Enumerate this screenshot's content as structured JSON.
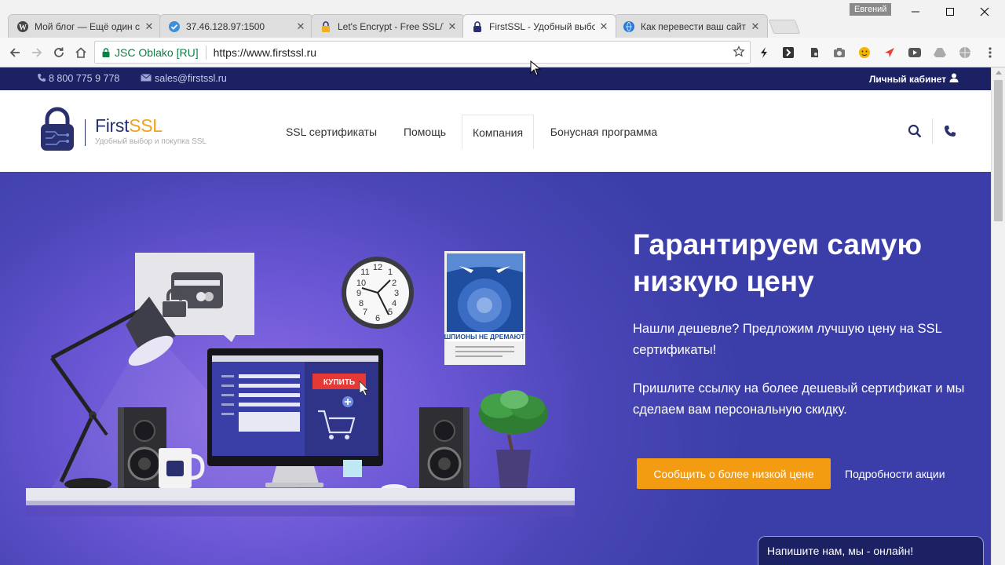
{
  "browser": {
    "tabs": [
      {
        "title": "Мой блог — Ещё один с",
        "icon": "wordpress-icon"
      },
      {
        "title": "37.46.128.97:1500",
        "icon": "checkmark-icon"
      },
      {
        "title": "Let's Encrypt - Free SSL/T",
        "icon": "lock-icon"
      },
      {
        "title": "FirstSSL - Удобный выбо",
        "icon": "firstssl-icon"
      },
      {
        "title": "Как перевести ваш сайт",
        "icon": "globe-icon"
      }
    ],
    "active_tab": 3,
    "profile_name": "Евгений",
    "secure_label": "JSC Oblako [RU]",
    "url": "https://www.firstssl.ru"
  },
  "site": {
    "topbar": {
      "phone": "8 800 775 9 778",
      "email": "sales@firstssl.ru",
      "account": "Личный кабинет"
    },
    "brand": {
      "name_first": "First",
      "name_ssl": "SSL",
      "tagline": "Удобный выбор и покупка SSL"
    },
    "nav": [
      {
        "label": "SSL сертификаты"
      },
      {
        "label": "Помощь"
      },
      {
        "label": "Компания"
      },
      {
        "label": "Бонусная программа"
      }
    ],
    "hero": {
      "title": "Гарантируем самую низкую цену",
      "paragraph1": "Нашли дешевле? Предложим лучшую цену на SSL сертификаты!",
      "paragraph2": "Пришлите ссылку на более дешевый сертификат и мы сделаем вам персональную скидку.",
      "cta_label": "Сообщить о более низкой цене",
      "more_label": "Подробности акции",
      "buy_label": "КУПИТЬ",
      "poster_text": "ШПИОНЫ НЕ ДРЕМАЮТ"
    },
    "chat_label": "Напишите нам, мы - онлайн!"
  },
  "colors": {
    "topbar_bg": "#1b2163",
    "brand_accent": "#f2a21b",
    "cta_bg": "#f39c12",
    "secure_green": "#0b8043"
  }
}
